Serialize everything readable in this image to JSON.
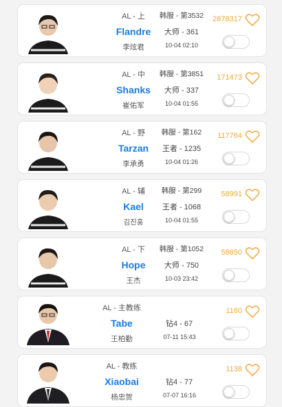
{
  "colors": {
    "name_blue": "#1a7be0",
    "likes_orange": "#f0a73c"
  },
  "players": [
    {
      "team": "AL - 上",
      "name": "Flandre",
      "real_name": "李炫君",
      "server": "韩服 - 第3532",
      "rank": "大师 - 361",
      "time": "10-04 02:10",
      "likes": "2878317",
      "icon": "heart-icon",
      "coach": false
    },
    {
      "team": "AL - 中",
      "name": "Shanks",
      "real_name": "崔佑军",
      "server": "韩服 - 第3851",
      "rank": "大师 - 337",
      "time": "10-04 01:55",
      "likes": "171473",
      "icon": "heart-icon",
      "coach": false
    },
    {
      "team": "AL - 野",
      "name": "Tarzan",
      "real_name": "李承勇",
      "server": "韩服 - 第162",
      "rank": "王者 - 1235",
      "time": "10-04 01:26",
      "likes": "117764",
      "icon": "heart-icon",
      "coach": false
    },
    {
      "team": "AL - 辅",
      "name": "Kael",
      "real_name": "김진홍",
      "server": "韩服 - 第299",
      "rank": "王者 - 1068",
      "time": "10-04 01:55",
      "likes": "58991",
      "icon": "heart-icon",
      "coach": false
    },
    {
      "team": "AL - 下",
      "name": "Hope",
      "real_name": "王杰",
      "server": "韩服 - 第1052",
      "rank": "大师 - 750",
      "time": "10-03 23:42",
      "likes": "58650",
      "icon": "heart-icon",
      "coach": false
    },
    {
      "team": "AL - 主教练",
      "name": "Tabe",
      "real_name": "王柏勤",
      "server": "",
      "rank": "钻4 - 67",
      "time": "07-11 15:43",
      "likes": "1160",
      "icon": "heart-icon",
      "coach": true
    },
    {
      "team": "AL - 教练",
      "name": "Xiaobai",
      "real_name": "杨忠贺",
      "server": "",
      "rank": "钻4 - 77",
      "time": "07-07 16:16",
      "likes": "1138",
      "icon": "heart-icon",
      "coach": true
    }
  ]
}
